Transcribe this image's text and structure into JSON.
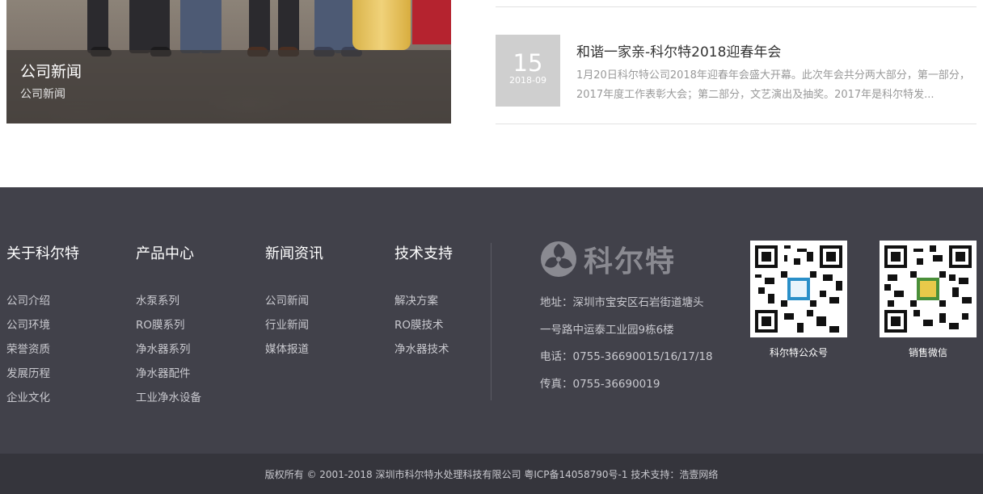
{
  "feature": {
    "title": "公司新闻",
    "subtitle": "公司新闻"
  },
  "news": {
    "day": "15",
    "year_month": "2018-09",
    "title": "和谐一家亲-科尔特2018迎春年会",
    "description": "1月20日科尔特公司2018年迎春年会盛大开幕。此次年会共分两大部分，第一部分，2017年度工作表彰大会；第二部分，文艺演出及抽奖。2017年是科尔特发..."
  },
  "footer": {
    "columns": [
      {
        "title": "关于科尔特",
        "links": [
          "公司介绍",
          "公司环境",
          "荣誉资质",
          "发展历程",
          "企业文化"
        ]
      },
      {
        "title": "产品中心",
        "links": [
          "水泵系列",
          "RO膜系列",
          "净水器系列",
          "净水器配件",
          "工业净水设备"
        ]
      },
      {
        "title": "新闻资讯",
        "links": [
          "公司新闻",
          "行业新闻",
          "媒体报道"
        ]
      },
      {
        "title": "技术支持",
        "links": [
          "解决方案",
          "RO膜技术",
          "净水器技术"
        ]
      }
    ],
    "logo_text": "科尔特",
    "contact": {
      "address_line1": "地址：深圳市宝安区石岩街道塘头",
      "address_line2": "一号路中运泰工业园9栋6楼",
      "phone": "电话：0755-36690015/16/17/18",
      "fax": "传真：0755-36690019"
    },
    "qr_codes": [
      {
        "label": "科尔特公众号"
      },
      {
        "label": "销售微信"
      }
    ],
    "copyright": "版权所有 © 2001-2018 深圳市科尔特水处理科技有限公司 粤ICP备14058790号-1 技术支持：浩壹网络"
  },
  "colors": {
    "footer_bg": "#41414a",
    "copyright_bg": "#35353c",
    "date_box_bg": "#cfcfcf"
  }
}
